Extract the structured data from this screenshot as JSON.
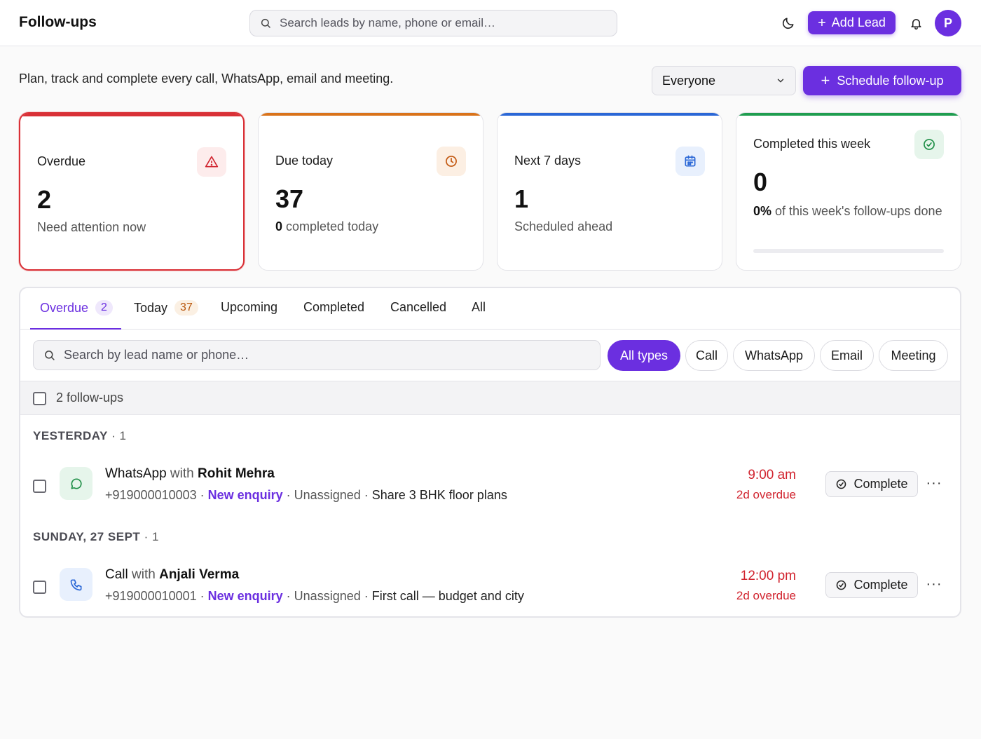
{
  "header": {
    "title": "Follow-ups",
    "search_placeholder": "Search leads by name, phone or email…",
    "add_lead_label": "Add Lead",
    "avatar_initial": "P"
  },
  "subheader": {
    "subtitle": "Plan, track and complete every call, WhatsApp, email and meeting.",
    "owner_filter": "Everyone",
    "schedule_label": "Schedule follow-up"
  },
  "stats": {
    "overdue": {
      "title": "Overdue",
      "value": "2",
      "sub": "Need attention now",
      "accent": "#d93036"
    },
    "due_today": {
      "title": "Due today",
      "value": "37",
      "sub_value": "0",
      "sub_text": " completed today",
      "accent": "#d9731a"
    },
    "next7": {
      "title": "Next 7 days",
      "value": "1",
      "sub": "Scheduled ahead",
      "accent": "#2a67d6"
    },
    "week": {
      "title": "Completed this week",
      "value": "0",
      "sub_value": "0%",
      "sub_text": " of this week's follow-ups done",
      "progress": 0,
      "accent": "#1f9d4f"
    }
  },
  "tabs": {
    "overdue": {
      "label": "Overdue",
      "count": "2"
    },
    "today": {
      "label": "Today",
      "count": "37"
    },
    "upcoming": {
      "label": "Upcoming"
    },
    "completed": {
      "label": "Completed"
    },
    "cancelled": {
      "label": "Cancelled"
    },
    "all": {
      "label": "All"
    }
  },
  "filters": {
    "search_placeholder": "Search by lead name or phone…",
    "types": [
      "All types",
      "Call",
      "WhatsApp",
      "Email",
      "Meeting"
    ],
    "selected_type": "All types"
  },
  "list": {
    "count_label": "2 follow-ups",
    "groups": [
      {
        "name": "YESTERDAY",
        "count": "· 1",
        "item": {
          "type": "WhatsApp",
          "with_word": " with ",
          "lead": "Rohit Mehra",
          "phone": "+919000010003",
          "stage": "New enquiry",
          "assignee": "Unassigned",
          "note": "Share 3 BHK floor plans",
          "time": "9:00 am",
          "overdue": "2d overdue",
          "icon": "whatsapp-chat-icon",
          "complete_label": "Complete"
        }
      },
      {
        "name": "SUNDAY, 27 SEPT",
        "count": "· 1",
        "item": {
          "type": "Call",
          "with_word": " with ",
          "lead": "Anjali Verma",
          "phone": "+919000010001",
          "stage": "New enquiry",
          "assignee": "Unassigned",
          "note": "First call — budget and city",
          "time": "12:00 pm",
          "overdue": "2d overdue",
          "icon": "phone-icon",
          "complete_label": "Complete"
        }
      }
    ]
  },
  "separator": " · ",
  "more_glyph": "···"
}
